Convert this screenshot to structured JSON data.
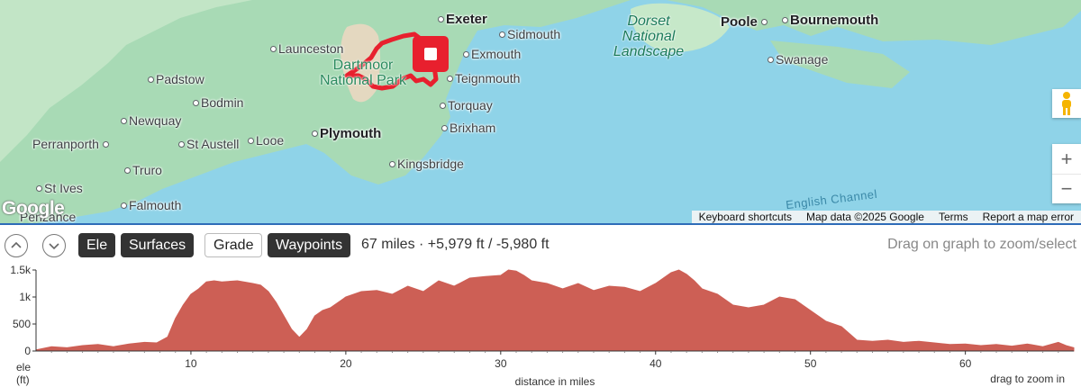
{
  "map": {
    "places": [
      {
        "name": "Exeter",
        "big": true
      },
      {
        "name": "Launceston",
        "big": false
      },
      {
        "name": "Sidmouth",
        "big": false
      },
      {
        "name": "Exmouth",
        "big": false
      },
      {
        "name": "Teignmouth",
        "big": false
      },
      {
        "name": "Padstow",
        "big": false
      },
      {
        "name": "Bodmin",
        "big": false
      },
      {
        "name": "Torquay",
        "big": false
      },
      {
        "name": "Newquay",
        "big": false
      },
      {
        "name": "Brixham",
        "big": false
      },
      {
        "name": "Perranporth",
        "big": false
      },
      {
        "name": "St Austell",
        "big": false
      },
      {
        "name": "Looe",
        "big": false
      },
      {
        "name": "Plymouth",
        "big": true
      },
      {
        "name": "Truro",
        "big": false
      },
      {
        "name": "Kingsbridge",
        "big": false
      },
      {
        "name": "St Ives",
        "big": false
      },
      {
        "name": "Falmouth",
        "big": false
      },
      {
        "name": "Penzance",
        "big": false
      },
      {
        "name": "Poole",
        "big": true
      },
      {
        "name": "Bournemouth",
        "big": true
      },
      {
        "name": "Swanage",
        "big": false
      }
    ],
    "parks": {
      "dartmoor_line1": "Dartmoor",
      "dartmoor_line2": "National Park",
      "dorset_line1": "Dorset",
      "dorset_line2": "National",
      "dorset_line3": "Landscape"
    },
    "sea_label": "English Channel",
    "logo": "Google",
    "attribution": [
      "Keyboard shortcuts",
      "Map data ©2025 Google",
      "Terms",
      "Report a map error"
    ],
    "zoom_in": "+",
    "zoom_out": "−"
  },
  "toolbar": {
    "tabs": [
      {
        "label": "Ele",
        "active": true
      },
      {
        "label": "Surfaces",
        "active": true
      },
      {
        "label": "Grade",
        "active": false
      },
      {
        "label": "Waypoints",
        "active": true
      }
    ],
    "stats": "67 miles · +5,979 ft / -5,980 ft",
    "hint": "Drag on graph to zoom/select"
  },
  "colors": {
    "route": "#e8202e",
    "elevation_fill": "#cd5f55",
    "divider": "#2e6cb8"
  },
  "chart_data": {
    "type": "area",
    "ylabel": "ele",
    "ylabel_unit": "(ft)",
    "xlabel": "distance in miles",
    "note": "drag to zoom in",
    "xlim": [
      0,
      67
    ],
    "ylim": [
      0,
      1500
    ],
    "y_ticks": [
      {
        "v": 0,
        "label": "0"
      },
      {
        "v": 500,
        "label": "500"
      },
      {
        "v": 1000,
        "label": "1k"
      },
      {
        "v": 1500,
        "label": "1.5k"
      }
    ],
    "x_ticks": [
      10,
      20,
      30,
      40,
      50,
      60
    ],
    "x": [
      0,
      1,
      2,
      3,
      4,
      5,
      6,
      7,
      7.8,
      8.5,
      9,
      9.5,
      10,
      10.5,
      11,
      11.5,
      12,
      13,
      14,
      14.5,
      15,
      15.5,
      16,
      16.5,
      17,
      17.5,
      18,
      18.5,
      19,
      20,
      21,
      22,
      23,
      24,
      25,
      26,
      27,
      28,
      29,
      30,
      30.5,
      31,
      31.5,
      32,
      33,
      34,
      35,
      36,
      37,
      38,
      39,
      40,
      41,
      41.5,
      42,
      42.5,
      43,
      44,
      45,
      46,
      47,
      48,
      49,
      49.5,
      50,
      51,
      52,
      53,
      54,
      55,
      56,
      57,
      58,
      59,
      60,
      61,
      62,
      63,
      64,
      65,
      66,
      66.5,
      67
    ],
    "values": [
      20,
      80,
      60,
      100,
      120,
      80,
      130,
      160,
      150,
      260,
      600,
      850,
      1050,
      1150,
      1280,
      1300,
      1280,
      1300,
      1250,
      1220,
      1100,
      900,
      650,
      400,
      250,
      400,
      650,
      750,
      800,
      1000,
      1100,
      1120,
      1050,
      1200,
      1100,
      1300,
      1200,
      1350,
      1380,
      1400,
      1500,
      1480,
      1400,
      1300,
      1250,
      1150,
      1250,
      1120,
      1200,
      1180,
      1100,
      1250,
      1450,
      1500,
      1420,
      1300,
      1150,
      1050,
      850,
      800,
      850,
      1000,
      950,
      850,
      750,
      550,
      450,
      200,
      180,
      200,
      160,
      180,
      150,
      120,
      130,
      100,
      120,
      90,
      130,
      80,
      160,
      100,
      60
    ]
  }
}
